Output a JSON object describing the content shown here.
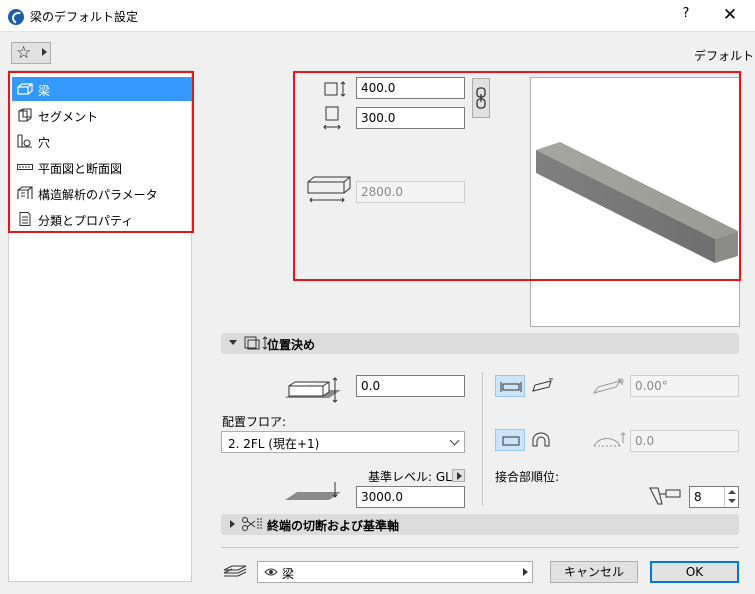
{
  "window": {
    "title": "梁のデフォルト設定",
    "help": "?",
    "close": "✕"
  },
  "favorites": {
    "icon": "star-icon"
  },
  "header": {
    "default_label": "デフォルト"
  },
  "nav": {
    "items": [
      {
        "label": "梁",
        "icon": "beam-icon",
        "selected": true
      },
      {
        "label": "セグメント",
        "icon": "segment-icon"
      },
      {
        "label": "穴",
        "icon": "hole-icon"
      },
      {
        "label": "平面図と断面図",
        "icon": "floorplan-section-icon"
      },
      {
        "label": "構造解析のパラメータ",
        "icon": "structural-analysis-icon"
      },
      {
        "label": "分類とプロパティ",
        "icon": "classification-icon"
      }
    ]
  },
  "geometry": {
    "height_value": "400.0",
    "width_value": "300.0",
    "length_value": "2800.0"
  },
  "positioning": {
    "title": "位置決め",
    "offset_value": "0.0",
    "home_story_label": "配置フロア:",
    "home_story_value": "2. 2FL (現在+1)",
    "ref_level_label": "基準レベル: GL",
    "ref_level_value": "3000.0",
    "slant_angle_value": "0.00°",
    "arc_value": "0.0",
    "priority_label": "接合部順位:",
    "priority_value": "8"
  },
  "end_cuts": {
    "title": "終端の切断および基準軸"
  },
  "footer": {
    "layer_value": "梁",
    "cancel_label": "キャンセル",
    "ok_label": "OK"
  },
  "colors": {
    "selection": "#3399ff",
    "highlight_box": "#e8151b",
    "beam_gray": "#8a8a8a"
  }
}
